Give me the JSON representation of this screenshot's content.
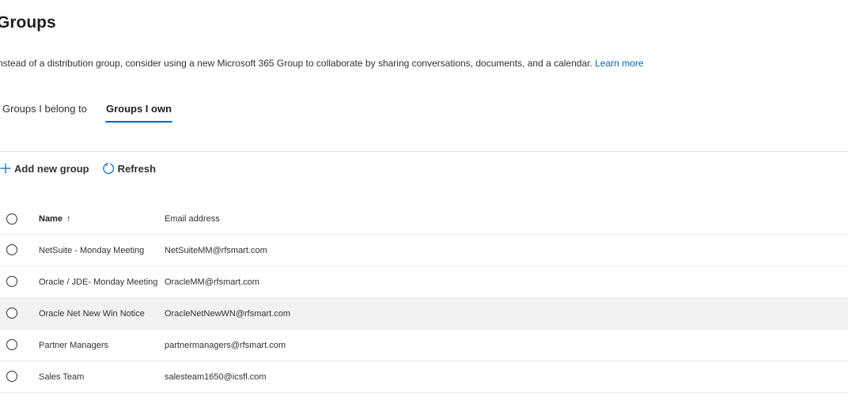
{
  "page": {
    "title": "Groups",
    "intro_text": "nstead of a distribution group, consider using a new Microsoft 365 Group to collaborate by sharing conversations, documents, and a calendar.",
    "learn_more": "Learn more"
  },
  "tabs": [
    {
      "label": "Groups I belong to",
      "active": false
    },
    {
      "label": "Groups I own",
      "active": true
    }
  ],
  "toolbar": {
    "add_label": "Add new group",
    "refresh_label": "Refresh"
  },
  "columns": {
    "name": "Name",
    "sort_indicator": "↑",
    "email": "Email address"
  },
  "rows": [
    {
      "name": "NetSuite - Monday Meeting",
      "email": "NetSuiteMM@rfsmart.com"
    },
    {
      "name": "Oracle / JDE- Monday Meeting",
      "email": "OracleMM@rfsmart.com"
    },
    {
      "name": "Oracle Net New Win Notice",
      "email": "OracleNetNewWN@rfsmart.com"
    },
    {
      "name": "Partner Managers",
      "email": "partnermanagers@rfsmart.com"
    },
    {
      "name": "Sales Team",
      "email": "salesteam1650@icsfl.com"
    }
  ],
  "colors": {
    "accent": "#0067b8",
    "row_highlight": "#f3f2f1",
    "divider": "#e1dfdd"
  },
  "icons": {
    "add": "plus-icon",
    "refresh": "refresh-icon",
    "sort": "arrow-up-icon",
    "select": "radio-circle-icon"
  }
}
